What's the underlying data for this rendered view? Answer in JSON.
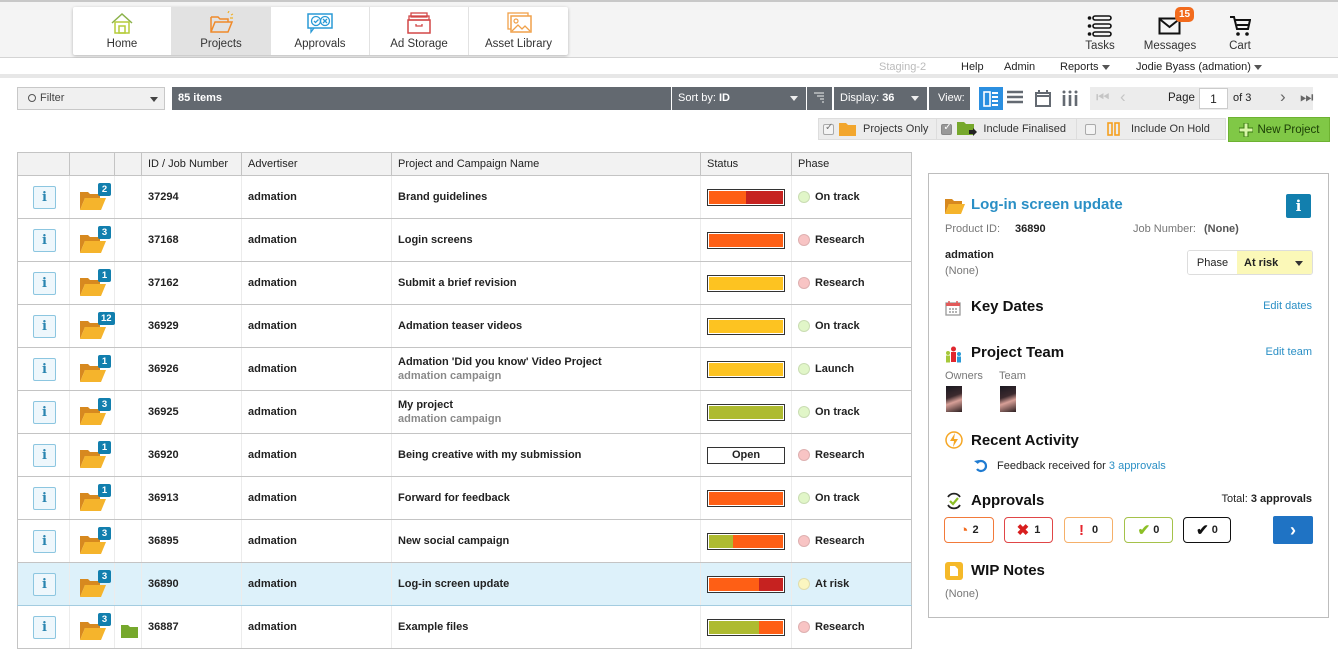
{
  "nav": {
    "tabs": [
      {
        "label": "Home",
        "icon": "home-icon",
        "active": false
      },
      {
        "label": "Projects",
        "icon": "projects-folder-icon",
        "active": true
      },
      {
        "label": "Approvals",
        "icon": "approvals-icon",
        "active": false
      },
      {
        "label": "Ad Storage",
        "icon": "ad-storage-icon",
        "active": false
      },
      {
        "label": "Asset Library",
        "icon": "asset-library-icon",
        "active": false
      }
    ],
    "right": [
      {
        "label": "Tasks",
        "icon": "tasks-icon"
      },
      {
        "label": "Messages",
        "icon": "envelope-icon",
        "badge": "15"
      },
      {
        "label": "Cart",
        "icon": "cart-icon"
      }
    ]
  },
  "subbar": {
    "environment": "Staging-2",
    "help": "Help",
    "admin": "Admin",
    "reports": "Reports",
    "user": "Jodie Byass (admation)"
  },
  "toolbar": {
    "filter_label": "Filter",
    "items_count": "85 items",
    "sort_prefix": "Sort by:",
    "sort_value": "ID",
    "display_prefix": "Display:",
    "display_value": "36",
    "view_label": "View:",
    "page_label": "Page",
    "page_value": "1",
    "page_total": "of 3"
  },
  "options": {
    "projects_only": {
      "label": "Projects Only",
      "checked": true
    },
    "include_finalised": {
      "label": "Include Finalised",
      "checked": true
    },
    "include_on_hold": {
      "label": "Include On Hold",
      "checked": false
    },
    "new_project": "New Project"
  },
  "colors": {
    "orange": "#fe5f15",
    "red": "#c62220",
    "yellow": "#fdc321",
    "olive": "#aebb30",
    "dot_green": "#e1f6c8",
    "dot_red": "#f8c4c4",
    "dot_yellow": "#fbf6c0",
    "accent": "#2a8fc5"
  },
  "table": {
    "headers": [
      "",
      "",
      "",
      "ID / Job Number",
      "Advertiser",
      "Project and Campaign Name",
      "Status",
      "Phase"
    ],
    "rows": [
      {
        "count": "2",
        "id": "37294",
        "advertiser": "admation",
        "name": "Brand guidelines",
        "campaign": "",
        "status": [
          [
            "orange",
            0.5
          ],
          [
            "red",
            0.5
          ]
        ],
        "phase": "On track",
        "dot": "dot_green",
        "selected": false
      },
      {
        "count": "3",
        "id": "37168",
        "advertiser": "admation",
        "name": "Login screens",
        "campaign": "",
        "status": [
          [
            "orange",
            1
          ]
        ],
        "phase": "Research",
        "dot": "dot_red",
        "selected": false
      },
      {
        "count": "1",
        "id": "37162",
        "advertiser": "admation",
        "name": "Submit a brief revision",
        "campaign": "",
        "status": [
          [
            "yellow",
            1
          ]
        ],
        "phase": "Research",
        "dot": "dot_red",
        "selected": false
      },
      {
        "count": "12",
        "id": "36929",
        "advertiser": "admation",
        "name": "Admation teaser videos",
        "campaign": "",
        "status": [
          [
            "yellow",
            1
          ]
        ],
        "phase": "On track",
        "dot": "dot_green",
        "selected": false
      },
      {
        "count": "1",
        "id": "36926",
        "advertiser": "admation",
        "name": "Admation 'Did you know' Video Project",
        "campaign": "admation campaign",
        "status": [
          [
            "yellow",
            1
          ]
        ],
        "phase": "Launch",
        "dot": "dot_green",
        "selected": false
      },
      {
        "count": "3",
        "id": "36925",
        "advertiser": "admation",
        "name": "My project",
        "campaign": "admation campaign",
        "status": [
          [
            "olive",
            1
          ]
        ],
        "phase": "On track",
        "dot": "dot_green",
        "selected": false
      },
      {
        "count": "1",
        "id": "36920",
        "advertiser": "admation",
        "name": "Being creative with my submission",
        "campaign": "",
        "status_text": "Open",
        "status": [],
        "phase": "Research",
        "dot": "dot_red",
        "selected": false
      },
      {
        "count": "1",
        "id": "36913",
        "advertiser": "admation",
        "name": "Forward for feedback",
        "campaign": "",
        "status": [
          [
            "orange",
            1
          ]
        ],
        "phase": "On track",
        "dot": "dot_green",
        "selected": false
      },
      {
        "count": "3",
        "id": "36895",
        "advertiser": "admation",
        "name": "New social campaign",
        "campaign": "",
        "status": [
          [
            "olive",
            0.33
          ],
          [
            "orange",
            0.67
          ]
        ],
        "phase": "Research",
        "dot": "dot_red",
        "selected": false
      },
      {
        "count": "3",
        "id": "36890",
        "advertiser": "admation",
        "name": "Log-in screen update",
        "campaign": "",
        "status": [
          [
            "orange",
            0.67
          ],
          [
            "red",
            0.33
          ]
        ],
        "phase": "At risk",
        "dot": "dot_yellow",
        "selected": true
      },
      {
        "count": "3",
        "id": "36887",
        "advertiser": "admation",
        "name": "Example files",
        "campaign": "",
        "status": [
          [
            "olive",
            0.67
          ],
          [
            "orange",
            0.33
          ]
        ],
        "phase": "Research",
        "dot": "dot_red",
        "selected": false,
        "finalised": true
      }
    ]
  },
  "panel": {
    "title": "Log-in screen update",
    "product_id_label": "Product ID:",
    "product_id": "36890",
    "job_number_label": "Job Number:",
    "job_number": "(None)",
    "advertiser": "admation",
    "campaign": "(None)",
    "phase_label": "Phase",
    "phase_value": "At risk",
    "key_dates": "Key Dates",
    "edit_dates": "Edit dates",
    "project_team": "Project Team",
    "edit_team": "Edit team",
    "owners_label": "Owners",
    "team_label": "Team",
    "recent_activity": "Recent Activity",
    "activity_text": "Feedback received for",
    "activity_link": "3 approvals",
    "approvals": "Approvals",
    "total_label": "Total:",
    "total_value": "3 approvals",
    "approval_counts": {
      "pending": "2",
      "rejected": "1",
      "warning": "0",
      "approved": "0",
      "final": "0"
    },
    "wip_notes": "WIP Notes",
    "wip_value": "(None)"
  }
}
